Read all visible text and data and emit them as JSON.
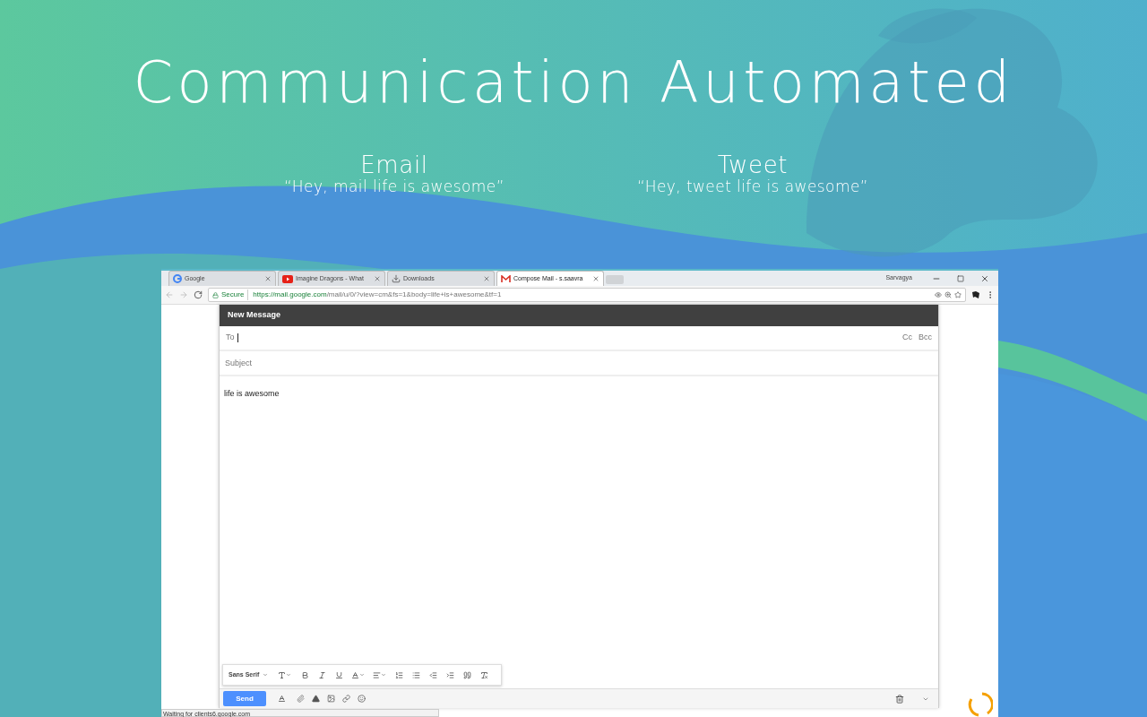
{
  "hero": {
    "title": "Communication Automated",
    "columns": [
      {
        "heading": "Email",
        "quote": "“Hey, mail life is awesome”"
      },
      {
        "heading": "Tweet",
        "quote": "“Hey, tweet life is awesome”"
      }
    ]
  },
  "browser": {
    "tabs": [
      {
        "kind": "google",
        "title": "Google",
        "selected": false
      },
      {
        "kind": "youtube",
        "title": "Imagine Dragons - What",
        "selected": false
      },
      {
        "kind": "download",
        "title": "Downloads",
        "selected": false
      },
      {
        "kind": "gmail",
        "title": "Compose Mail - s.saavra",
        "selected": true
      }
    ],
    "profile": "Sarvagya",
    "secure_label": "Secure",
    "url_host": "https://mail.google.com",
    "url_path": "/mail/u/0/?view=cm&fs=1&body=life+is+awesome&tf=1",
    "status": "Waiting for clients6.google.com"
  },
  "compose": {
    "header": "New Message",
    "to_label": "To",
    "cc": "Cc",
    "bcc": "Bcc",
    "subject_placeholder": "Subject",
    "body": "life is awesome",
    "font": "Sans Serif",
    "send": "Send"
  }
}
